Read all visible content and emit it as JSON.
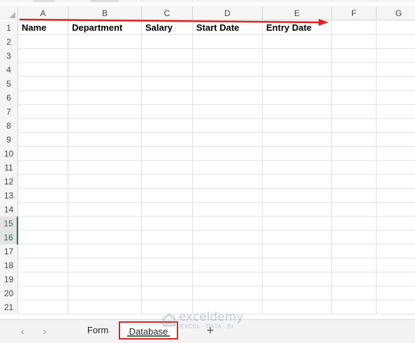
{
  "columns": [
    "A",
    "B",
    "C",
    "D",
    "E",
    "F",
    "G"
  ],
  "rows": [
    "1",
    "2",
    "3",
    "4",
    "5",
    "6",
    "7",
    "8",
    "9",
    "10",
    "11",
    "12",
    "13",
    "14",
    "15",
    "16",
    "17",
    "18",
    "19",
    "20",
    "21"
  ],
  "highlighted_rows": [
    "15",
    "16"
  ],
  "headers": {
    "A1": "Name",
    "B1": "Department",
    "C1": "Salary",
    "D1": "Start Date",
    "E1": "Entry Date"
  },
  "arrow_color": "#e02020",
  "sheet_tabs": [
    {
      "label": "Form",
      "active": false
    },
    {
      "label": "Database",
      "active": true
    }
  ],
  "nav": {
    "prev": "‹",
    "next": "›",
    "add": "+"
  },
  "watermark": {
    "name": "exceldemy",
    "sub": "EXCEL · DATA · BI"
  }
}
